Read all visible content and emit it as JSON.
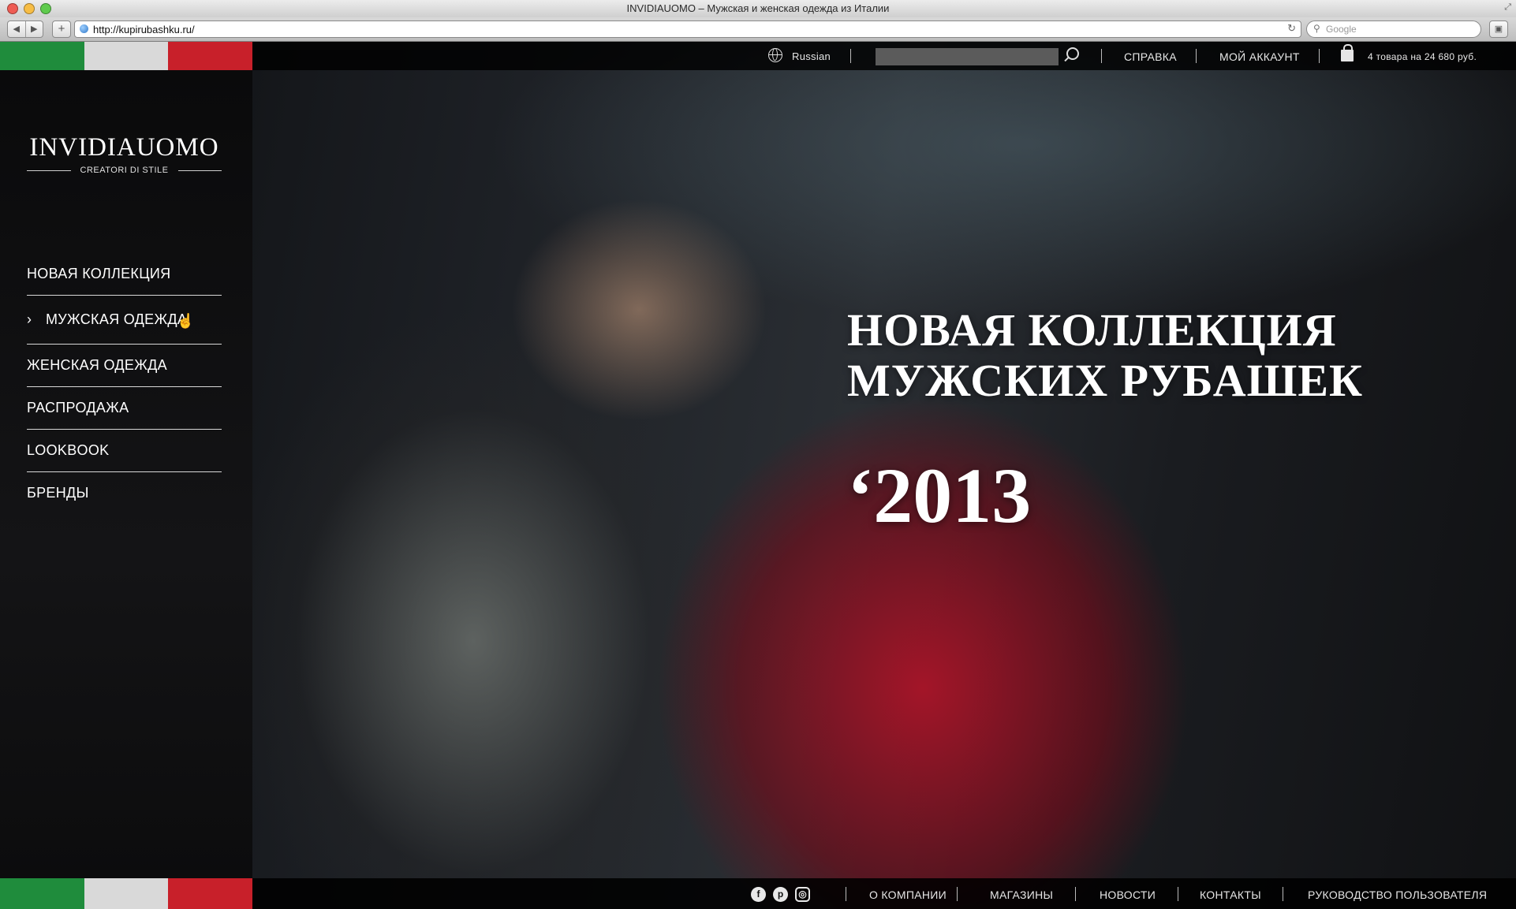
{
  "browser": {
    "window_title": "INVIDIAUOMO – Мужская и женская одежда из Италии",
    "url": "http://kupirubashku.ru/",
    "search_placeholder": "Google",
    "traffic_light_colors": [
      "#ee5c54",
      "#f7bd45",
      "#5fcb4d"
    ]
  },
  "flag_colors": [
    "#1f8c3c",
    "#d9d9d9",
    "#c8202a"
  ],
  "topbar": {
    "language": "Russian",
    "help": "СПРАВКА",
    "account": "МОЙ АККАУНТ",
    "cart_summary": "4 товара на 24 680 руб."
  },
  "brand": {
    "name": "INVIDIAUOMO",
    "tagline": "CREATORI DI STILE"
  },
  "menu": {
    "items": [
      {
        "label": "НОВАЯ КОЛЛЕКЦИЯ"
      },
      {
        "label": "МУЖСКАЯ ОДЕЖДА",
        "active": true
      },
      {
        "label": "ЖЕНСКАЯ ОДЕЖДА"
      },
      {
        "label": "РАСПРОДАЖА"
      },
      {
        "label": "LOOKBOOK"
      },
      {
        "label": "БРЕНДЫ"
      }
    ],
    "active_marker": "›"
  },
  "hero": {
    "line1": "НОВАЯ КОЛЛЕКЦИЯ",
    "line2": "МУЖСКИХ РУБАШЕК",
    "year": "‘2013"
  },
  "footer": {
    "social": [
      "facebook",
      "pinterest",
      "instagram"
    ],
    "social_glyphs": [
      "f",
      "p",
      "◎"
    ],
    "links": [
      "О КОМПАНИИ",
      "МАГАЗИНЫ",
      "НОВОСТИ",
      "КОНТАКТЫ",
      "РУКОВОДСТВО ПОЛЬЗОВАТЕЛЯ"
    ]
  }
}
